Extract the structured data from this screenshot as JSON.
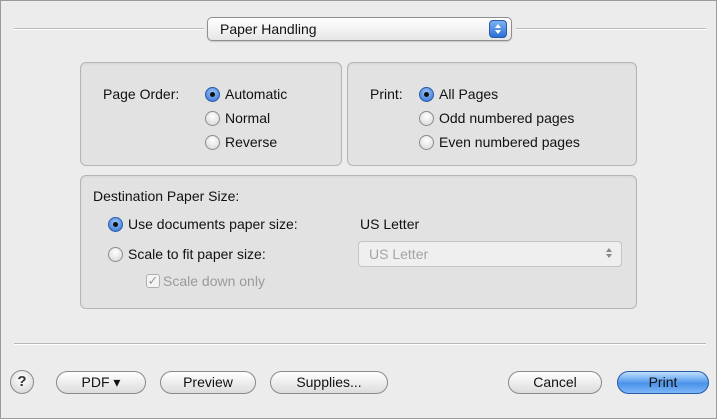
{
  "panel_select": {
    "label": "Paper Handling"
  },
  "page_order": {
    "label": "Page Order:",
    "options": [
      "Automatic",
      "Normal",
      "Reverse"
    ],
    "selected": "Automatic"
  },
  "print_range": {
    "label": "Print:",
    "options": [
      "All Pages",
      "Odd numbered pages",
      "Even numbered pages"
    ],
    "selected": "All Pages"
  },
  "destination": {
    "label": "Destination Paper Size:",
    "use_document_label": "Use documents paper size:",
    "document_size": "US Letter",
    "scale_label": "Scale to fit paper size:",
    "scale_size": "US Letter",
    "scale_down_label": "Scale down only",
    "scale_down_checked": true
  },
  "footer": {
    "help": "?",
    "pdf": "PDF ▾",
    "preview": "Preview",
    "supplies": "Supplies...",
    "cancel": "Cancel",
    "print": "Print"
  }
}
